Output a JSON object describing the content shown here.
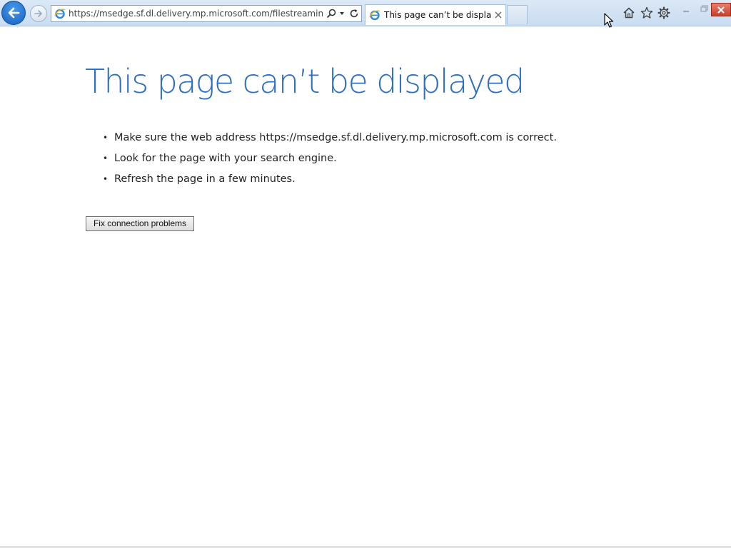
{
  "browser": {
    "address_url": "https://msedge.sf.dl.delivery.mp.microsoft.com/filestreamingservic",
    "tab_title": "This page can’t be displayed",
    "icons": {
      "back": "back-arrow-icon",
      "forward": "forward-arrow-icon",
      "favicon": "ie-logo-icon",
      "search": "search-icon",
      "dropdown": "chevron-down-icon",
      "refresh": "refresh-icon",
      "tab_close": "close-icon",
      "home": "home-icon",
      "favorites": "star-icon",
      "settings": "gear-icon",
      "minimize": "minimize-icon",
      "restore": "restore-icon",
      "close": "close-icon"
    },
    "colors": {
      "accent_blue": "#1560c0",
      "close_red": "#c7402b"
    }
  },
  "page": {
    "title": "This page can’t be displayed",
    "bullet": "•",
    "suggestions": [
      "Make sure the web address https://msedge.sf.dl.delivery.mp.microsoft.com is correct.",
      "Look for the page with your search engine.",
      "Refresh the page in a few minutes."
    ],
    "fix_button_label": "Fix connection problems",
    "title_color": "#2e6fbf"
  }
}
